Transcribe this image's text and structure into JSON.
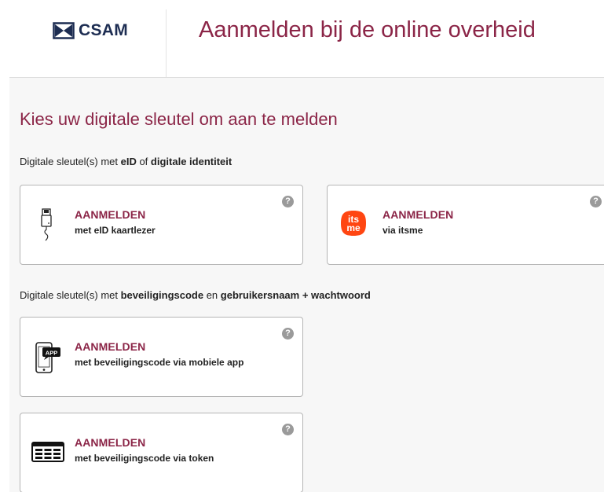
{
  "header": {
    "logo_text": "CSAM",
    "title": "Aanmelden bij de online overheid"
  },
  "main": {
    "page_title": "Kies uw digitale sleutel om aan te melden",
    "sections": [
      {
        "label_parts": [
          "Digitale sleutel(s) met ",
          "eID",
          " of ",
          "digitale identiteit"
        ],
        "cards": [
          {
            "heading": "AANMELDEN",
            "subtitle": "met eID kaartlezer",
            "icon": "eid-card-reader-icon",
            "help": "?"
          },
          {
            "heading": "AANMELDEN",
            "subtitle": "via itsme",
            "icon": "itsme-logo-icon",
            "icon_text_top": "its",
            "icon_text_bottom": "me",
            "help": "?"
          }
        ]
      },
      {
        "label_parts": [
          "Digitale sleutel(s) met ",
          "beveiligingscode",
          " en ",
          "gebruikersnaam + wachtwoord"
        ],
        "cards": [
          {
            "heading": "AANMELDEN",
            "subtitle": "met beveiligingscode via mobiele app",
            "icon": "mobile-app-icon",
            "icon_text": "APP",
            "help": "?"
          },
          {
            "heading": "AANMELDEN",
            "subtitle": "met beveiligingscode via token",
            "icon": "token-icon",
            "help": "?"
          }
        ]
      }
    ]
  },
  "colors": {
    "brand": "#8b2547",
    "itsme": "#ff4612",
    "logo": "#1d2d52",
    "background": "#f7f7f7"
  }
}
